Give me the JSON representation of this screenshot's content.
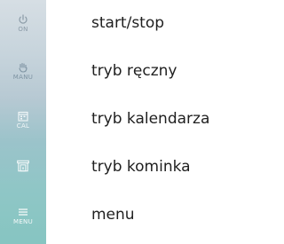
{
  "sidebar": {
    "buttons": [
      {
        "abbr": "ON",
        "icon": "power-icon",
        "description": "start/stop"
      },
      {
        "abbr": "MANU",
        "icon": "hand-icon",
        "description": "tryb ręczny"
      },
      {
        "abbr": "CAL",
        "icon": "calendar-icon",
        "description": "tryb kalendarza"
      },
      {
        "abbr": "",
        "icon": "fireplace-icon",
        "description": "tryb kominka"
      },
      {
        "abbr": "MENU",
        "icon": "menu-icon",
        "description": "menu"
      }
    ]
  },
  "colors": {
    "sidebar_top": "#d6dee4",
    "sidebar_bottom": "#86c5c1",
    "text": "#1f1f1f"
  }
}
